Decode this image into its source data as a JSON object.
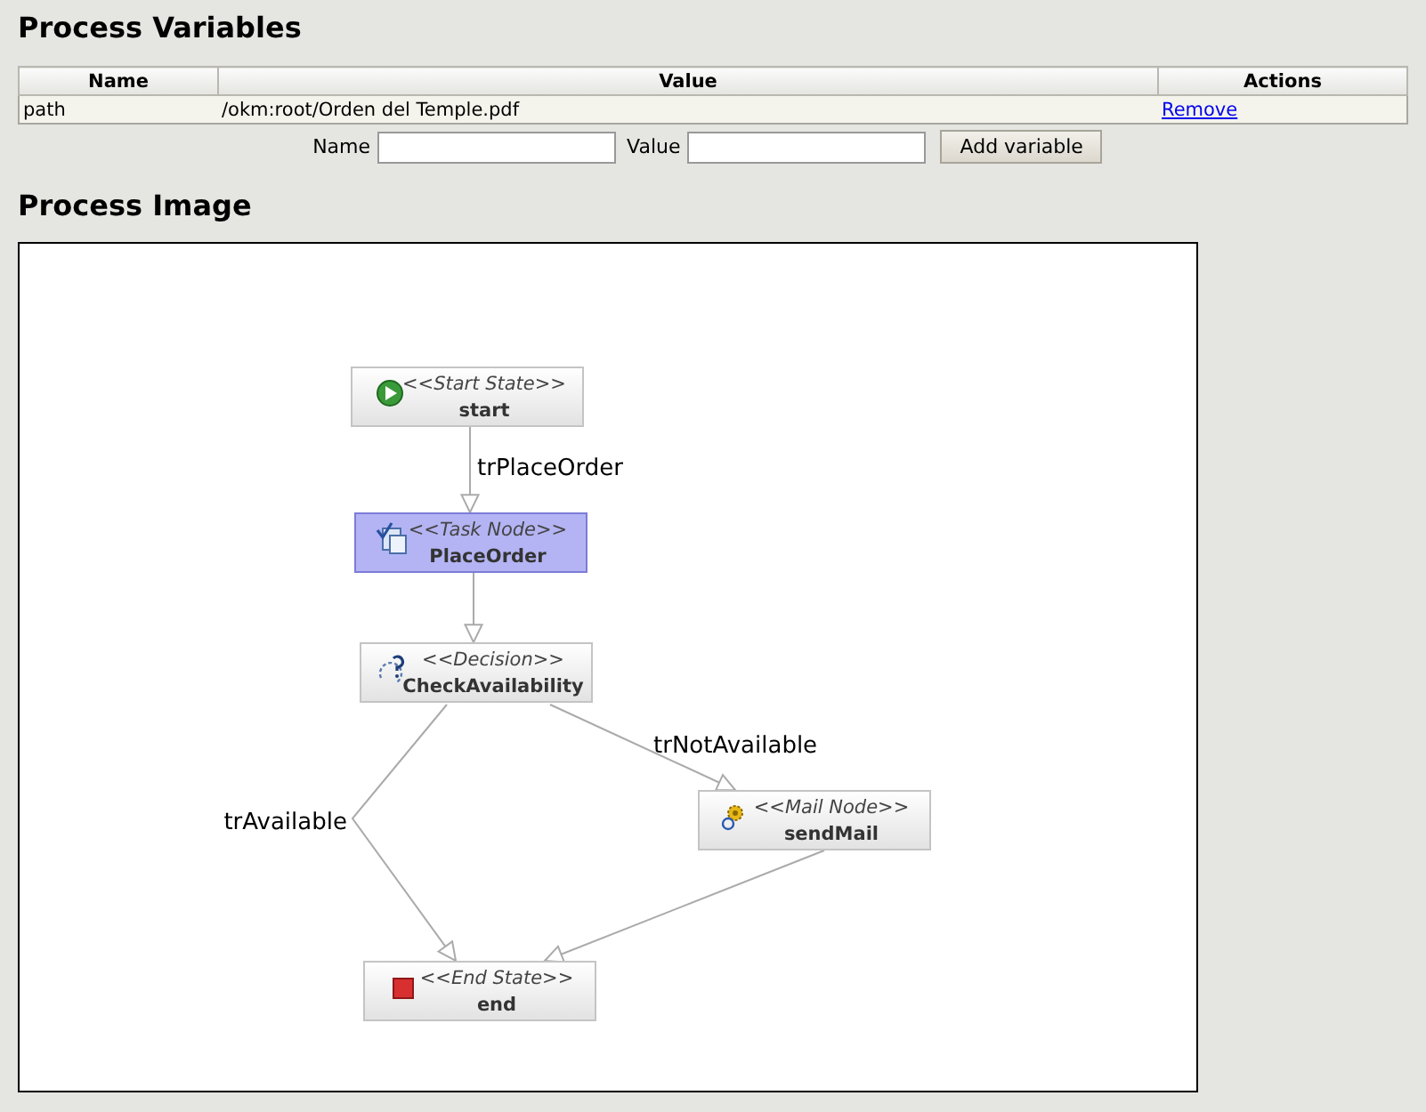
{
  "variables": {
    "title": "Process Variables",
    "columns": [
      "Name",
      "Value",
      "Actions"
    ],
    "rows": [
      {
        "name": "path",
        "value": "/okm:root/Orden del Temple.pdf",
        "action": "Remove"
      }
    ],
    "form": {
      "name_label": "Name",
      "value_label": "Value",
      "button": "Add variable"
    }
  },
  "process_image": {
    "title": "Process Image",
    "nodes": [
      {
        "kind": "start",
        "stereotype": "<<Start State>>",
        "name": "start",
        "selected": false
      },
      {
        "kind": "task",
        "stereotype": "<<Task Node>>",
        "name": "PlaceOrder",
        "selected": true
      },
      {
        "kind": "decision",
        "stereotype": "<<Decision>>",
        "name": "CheckAvailability",
        "selected": false
      },
      {
        "kind": "mail",
        "stereotype": "<<Mail Node>>",
        "name": "sendMail",
        "selected": false
      },
      {
        "kind": "end",
        "stereotype": "<<End State>>",
        "name": "end",
        "selected": false
      }
    ],
    "transition_labels": [
      "trPlaceOrder",
      "trNotAvailable",
      "trAvailable"
    ]
  }
}
